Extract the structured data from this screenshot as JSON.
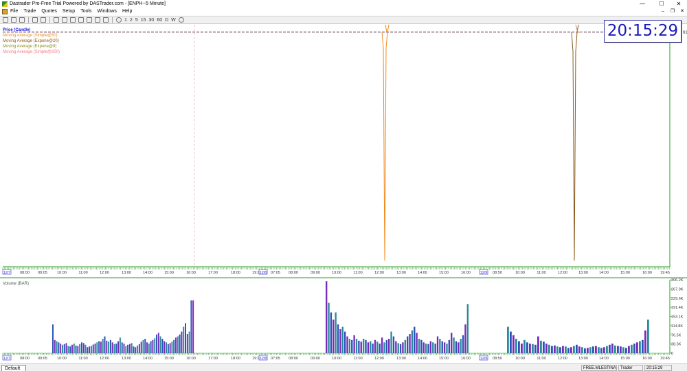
{
  "window": {
    "title": "Dastrader Pro-Free Trial Powered by DASTrader.com - [ENPH--5 Minute]",
    "minimize": "—",
    "maximize": "☐",
    "close": "✕"
  },
  "menu": [
    "File",
    "Trade",
    "Quotes",
    "Setup",
    "Tools",
    "Windows",
    "Help"
  ],
  "toolbar": {
    "periods": [
      "1",
      "2",
      "5",
      "15",
      "30",
      "60",
      "D",
      "W"
    ]
  },
  "clock": "20:15:29",
  "legend": [
    {
      "label": "Price (Candle)",
      "color": "#1a1ad0"
    },
    {
      "label": "Moving Average (Simple@50)",
      "color": "#f08a1a"
    },
    {
      "label": "Moving Average (Expone@20)",
      "color": "#8a5a1a"
    },
    {
      "label": "Moving Average (Expone@9)",
      "color": "#8a8a1a"
    },
    {
      "label": "Moving Average (Simple@200)",
      "color": "#f07a8a"
    }
  ],
  "price_right_label": "61",
  "volume_title": "Volume (BAR)",
  "volume_axis": [
    "306.2K",
    "267.9K",
    "229.6K",
    "191.4K",
    "153.1K",
    "114.8K",
    "76.5K",
    "38.3K",
    "0"
  ],
  "time_labels_top": [
    "08:00",
    "09:05",
    "10:00",
    "11:00",
    "12:00",
    "13:00",
    "14:00",
    "15:00",
    "16:00",
    "17:00",
    "18:00",
    "19:00",
    "07:05",
    "08:00",
    "09:00",
    "10:00",
    "11:00",
    "12:00",
    "13:00",
    "14:00",
    "15:00",
    "16:00",
    "08:50",
    "10:00",
    "11:00",
    "12:00",
    "13:00",
    "14:00",
    "15:00",
    "16:00",
    "19:45"
  ],
  "date_labels": [
    "12/7",
    "12/8",
    "12/9"
  ],
  "status": {
    "tab": "Default",
    "account": "FREE.MLESTINA",
    "role": "Trader",
    "time": "20:15:29"
  },
  "colors": {
    "axis_green": "#2a9a2a",
    "volume_blue": "#2a52b8",
    "volume_purple": "#7a2ab8",
    "volume_teal": "#2a8a9a"
  },
  "chart_data": {
    "type": "bar",
    "title": "Volume (BAR)",
    "ylim": [
      0,
      306200
    ],
    "segments": [
      {
        "name": "day1",
        "values": [
          120000,
          55000,
          50000,
          45000,
          40000,
          35000,
          38000,
          42000,
          30000,
          28000,
          35000,
          40000,
          32000,
          30000,
          38000,
          45000,
          42000,
          35000,
          25000,
          28000,
          30000,
          36000,
          40000,
          45000,
          50000,
          48000,
          60000,
          70000,
          52000,
          48000,
          55000,
          45000,
          38000,
          40000,
          50000,
          65000,
          45000,
          40000,
          30000,
          35000,
          38000,
          42000,
          28000,
          25000,
          32000,
          38000,
          48000,
          55000,
          60000,
          45000,
          40000,
          50000,
          55000,
          62000,
          78000,
          85000,
          70000,
          60000,
          50000,
          45000,
          38000,
          42000,
          48000,
          55000,
          65000,
          70000,
          78000,
          90000,
          110000,
          125000,
          80000,
          90000,
          220000,
          220000
        ]
      },
      {
        "name": "day2",
        "values": [
          300000,
          210000,
          170000,
          140000,
          170000,
          120000,
          100000,
          110000,
          90000,
          70000,
          60000,
          55000,
          75000,
          60000,
          52000,
          48000,
          60000,
          55000,
          45000,
          50000,
          40000,
          55000,
          48000,
          40000,
          65000,
          45000,
          55000,
          60000,
          90000,
          70000,
          50000,
          42000,
          38000,
          45000,
          55000,
          70000,
          80000,
          95000,
          110000,
          85000,
          60000,
          55000,
          45000,
          40000,
          38000,
          50000,
          45000,
          40000,
          70000,
          60000,
          50000,
          45000,
          40000,
          55000,
          85000,
          65000,
          50000,
          45000,
          60000,
          75000,
          120000,
          205000
        ]
      },
      {
        "name": "day3",
        "values": [
          110000,
          90000,
          75000,
          60000,
          50000,
          40000,
          55000,
          45000,
          40000,
          38000,
          35000,
          70000,
          52000,
          48000,
          40000,
          35000,
          30000,
          32000,
          28000,
          25000,
          30000,
          28000,
          22000,
          25000,
          30000,
          35000,
          28000,
          25000,
          20000,
          22000,
          25000,
          28000,
          30000,
          25000,
          22000,
          25000,
          30000,
          35000,
          40000,
          32000,
          30000,
          28000,
          25000,
          22000,
          30000,
          35000,
          40000,
          45000,
          50000,
          55000,
          95000,
          140000
        ]
      }
    ],
    "x_ticks": [
      "08:00",
      "09:05",
      "10:00",
      "11:00",
      "12:00",
      "13:00",
      "14:00",
      "15:00",
      "16:00",
      "17:00",
      "18:00",
      "19:00",
      "07:05",
      "08:00",
      "09:00",
      "10:00",
      "11:00",
      "12:00",
      "13:00",
      "14:00",
      "15:00",
      "16:00",
      "08:50",
      "10:00",
      "11:00",
      "12:00",
      "13:00",
      "14:00",
      "15:00",
      "16:00",
      "19:45"
    ]
  }
}
